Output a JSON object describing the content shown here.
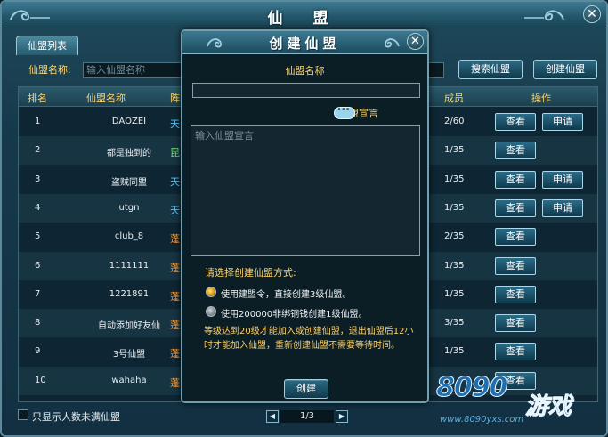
{
  "window": {
    "title": "仙 盟"
  },
  "tabs": [
    {
      "label": "仙盟列表"
    }
  ],
  "search": {
    "label": "仙盟名称:",
    "placeholder": "输入仙盟名称",
    "search_button": "搜索仙盟",
    "create_button": "创建仙盟"
  },
  "table": {
    "headers": {
      "rank": "排名",
      "name": "仙盟名称",
      "camp": "阵",
      "members": "成员",
      "action": "操作"
    },
    "view_label": "查看",
    "apply_label": "申请",
    "rows": [
      {
        "rank": "1",
        "name": "DAOZEI",
        "camp": "天",
        "camp_color": "blue",
        "members": "2/60",
        "apply": true
      },
      {
        "rank": "2",
        "name": "都是独到的",
        "camp": "昆",
        "camp_color": "green",
        "members": "1/35",
        "apply": false
      },
      {
        "rank": "3",
        "name": "盗贼同盟",
        "camp": "天",
        "camp_color": "blue",
        "members": "1/35",
        "apply": true
      },
      {
        "rank": "4",
        "name": "utgn",
        "camp": "天",
        "camp_color": "blue",
        "members": "1/35",
        "apply": true
      },
      {
        "rank": "5",
        "name": "club_8",
        "camp": "蓬",
        "camp_color": "orange",
        "members": "2/35",
        "apply": false
      },
      {
        "rank": "6",
        "name": "1111111",
        "camp": "蓬",
        "camp_color": "orange",
        "members": "1/35",
        "apply": false
      },
      {
        "rank": "7",
        "name": "1221891",
        "camp": "蓬",
        "camp_color": "orange",
        "members": "1/35",
        "apply": false
      },
      {
        "rank": "8",
        "name": "自动添加好友仙",
        "camp": "蓬",
        "camp_color": "orange",
        "members": "3/35",
        "apply": false
      },
      {
        "rank": "9",
        "name": "3号仙盟",
        "camp": "蓬",
        "camp_color": "orange",
        "members": "1/35",
        "apply": false
      },
      {
        "rank": "10",
        "name": "wahaha",
        "camp": "蓬",
        "camp_color": "orange",
        "members": "",
        "apply": false
      }
    ]
  },
  "footer": {
    "checkbox_label": "只显示人数未满仙盟",
    "page": "1/3"
  },
  "watermark": {
    "logo": "8090",
    "game": "游戏",
    "url": "www.8090yxs.com"
  },
  "dialog": {
    "title": "创建仙盟",
    "name_label": "仙盟名称",
    "manifesto_label": "仙盟宣言",
    "manifesto_placeholder": "输入仙盟宣言",
    "choose_label": "请选择创建仙盟方式:",
    "option1": "使用建盟令，直接创建3级仙盟。",
    "option2": "使用200000非绑铜钱创建1级仙盟。",
    "note": "等级达到20级才能加入或创建仙盟，退出仙盟后12小时才能加入仙盟，重新创建仙盟不需要等待时间。",
    "create_button": "创建"
  },
  "colors": {
    "gold_text": "#ffd36a",
    "camp_blue": "#5cc7ff",
    "camp_green": "#7be07b",
    "camp_orange": "#ff9a2e"
  }
}
